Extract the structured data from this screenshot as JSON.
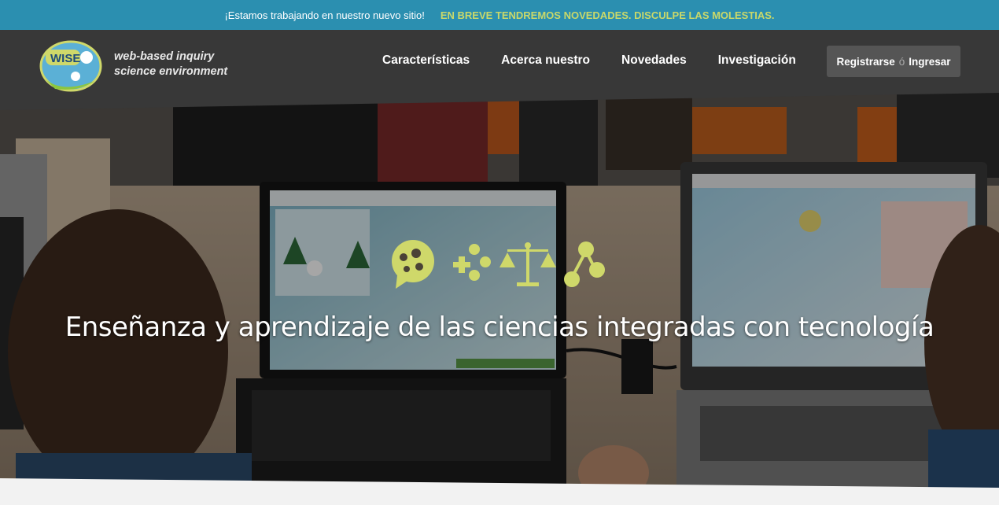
{
  "announcement": {
    "message": "¡Estamos trabajando en nuestro nuevo sitio!",
    "notice": "EN BREVE TENDREMOS NOVEDADES. DISCULPE LAS MOLESTIAS."
  },
  "brand": {
    "logo_text": "WISE",
    "tagline_line1": "web-based inquiry",
    "tagline_line2": "science environment"
  },
  "nav": {
    "items": [
      "Características",
      "Acerca nuestro",
      "Novedades",
      "Investigación"
    ]
  },
  "auth": {
    "register": "Registrarse",
    "or": "ó",
    "login": "Ingresar"
  },
  "hero": {
    "headline": "Enseñanza y aprendizaje de las ciencias integradas con tecnología",
    "icons": [
      "chat-bubble-icon",
      "gamepad-icon",
      "balance-scale-icon",
      "molecule-icon"
    ],
    "icon_color": "#cfd86a"
  },
  "colors": {
    "announcement_bg": "#2b8fb0",
    "notice_text": "#c9d86a",
    "navbar_bg": "#3a3a3a",
    "auth_bg": "#555555"
  }
}
